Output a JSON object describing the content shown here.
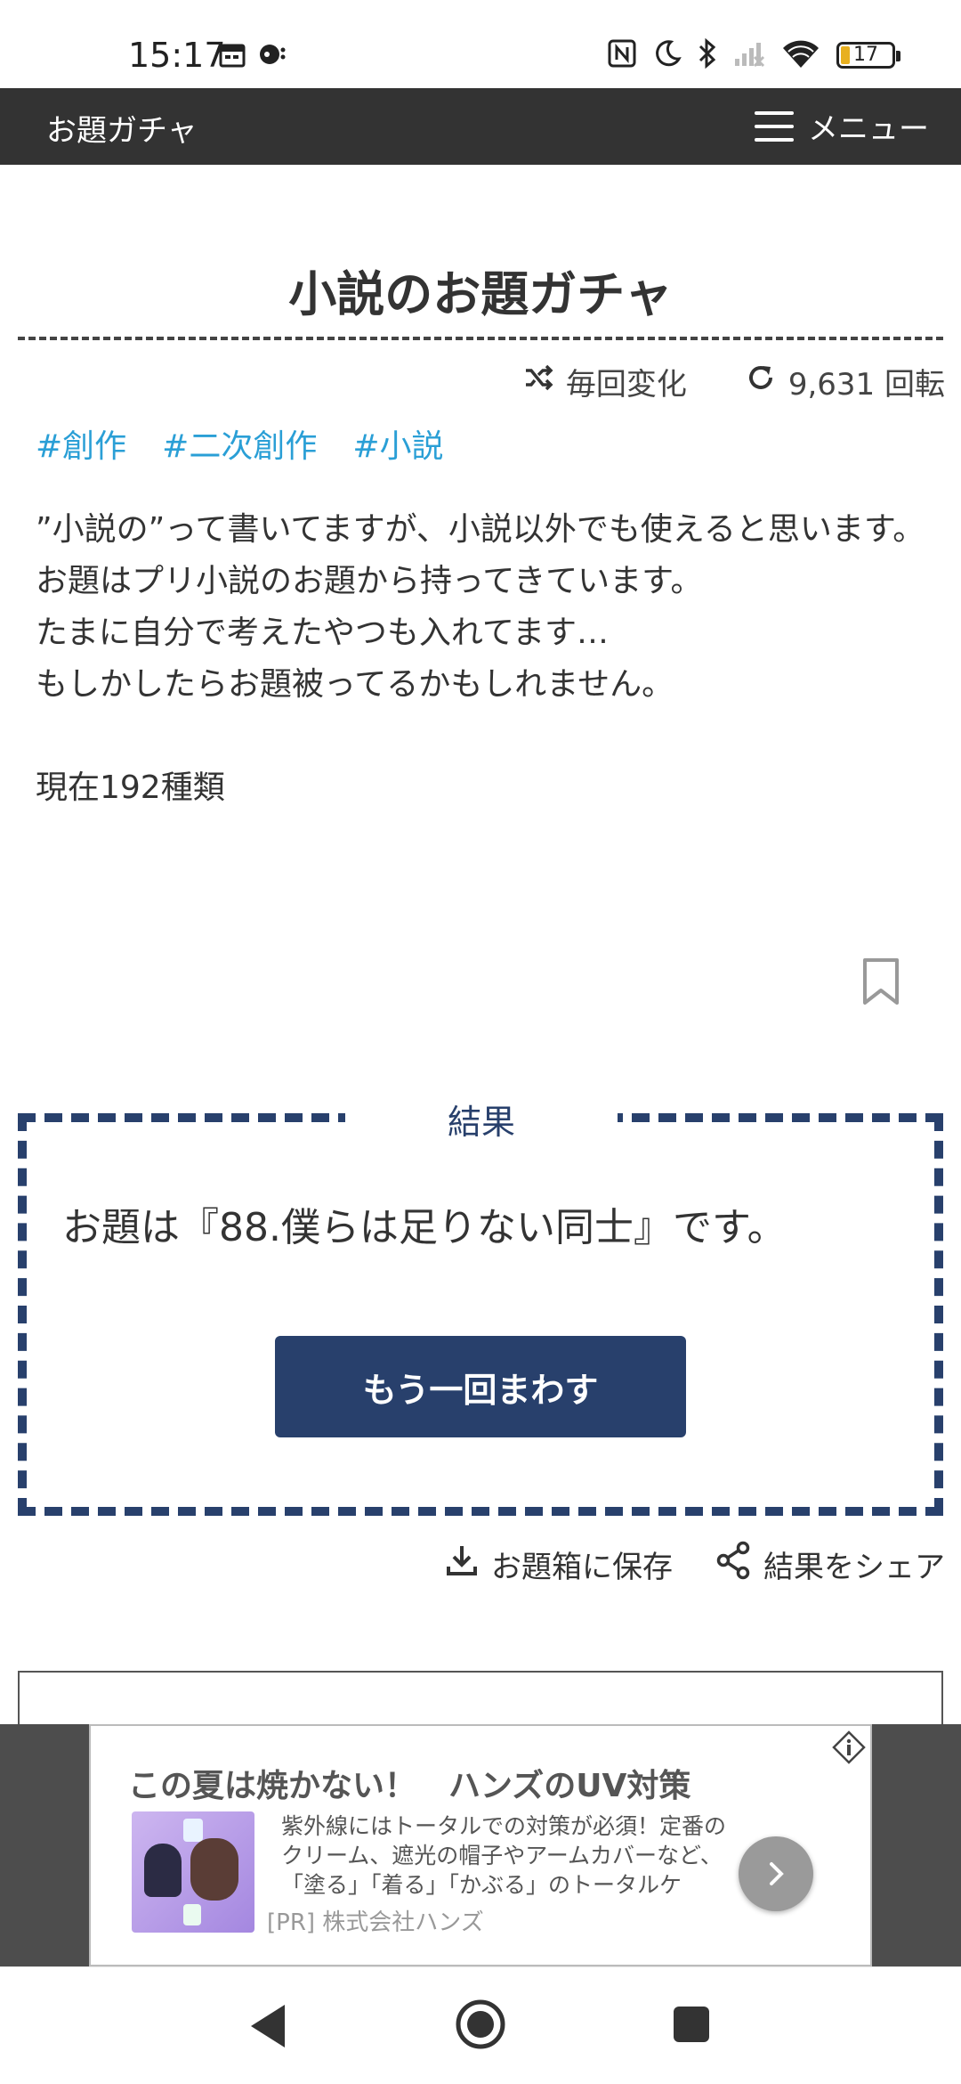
{
  "status_bar": {
    "time": "15:17",
    "battery": "17",
    "left_icons": [
      "calendar-icon",
      "notification-icon"
    ],
    "right_icons": [
      "nfc-icon",
      "moon-icon",
      "bluetooth-icon",
      "signal-icon",
      "wifi-icon",
      "battery-icon"
    ]
  },
  "header": {
    "site_title": "お題ガチャ",
    "menu_label": "メニュー"
  },
  "page": {
    "title": "小説のお題ガチャ",
    "mode_label": "毎回変化",
    "spin_count": "9,631 回転",
    "tags": [
      "#創作",
      "#二次創作",
      "#小説"
    ],
    "description": "”小説の”って書いてますが、小説以外でも使えると思います。\nお題はプリ小説のお題から持ってきています。\nたまに自分で考えたやつも入れてます…\nもしかしたらお題被ってるかもしれません。\n\n現在192種類"
  },
  "result": {
    "label": "結果",
    "text": "お題は『88.僕らは足りない同士』です。",
    "spin_again": "もう一回まわす"
  },
  "actions": {
    "save": "お題箱に保存",
    "share": "結果をシェア"
  },
  "ad": {
    "title": "この夏は焼かない！　ハンズのUV対策",
    "body": "紫外線にはトータルでの対策が必須！定番のクリーム、遮光の帽子やアームカバーなど、「塗る」「着る」「かぶる」のトータルケ",
    "sponsor": "[PR] 株式会社ハンズ"
  },
  "colors": {
    "header_bg": "#333333",
    "accent_navy": "#28406c",
    "tag_blue": "#2a9fd6"
  }
}
